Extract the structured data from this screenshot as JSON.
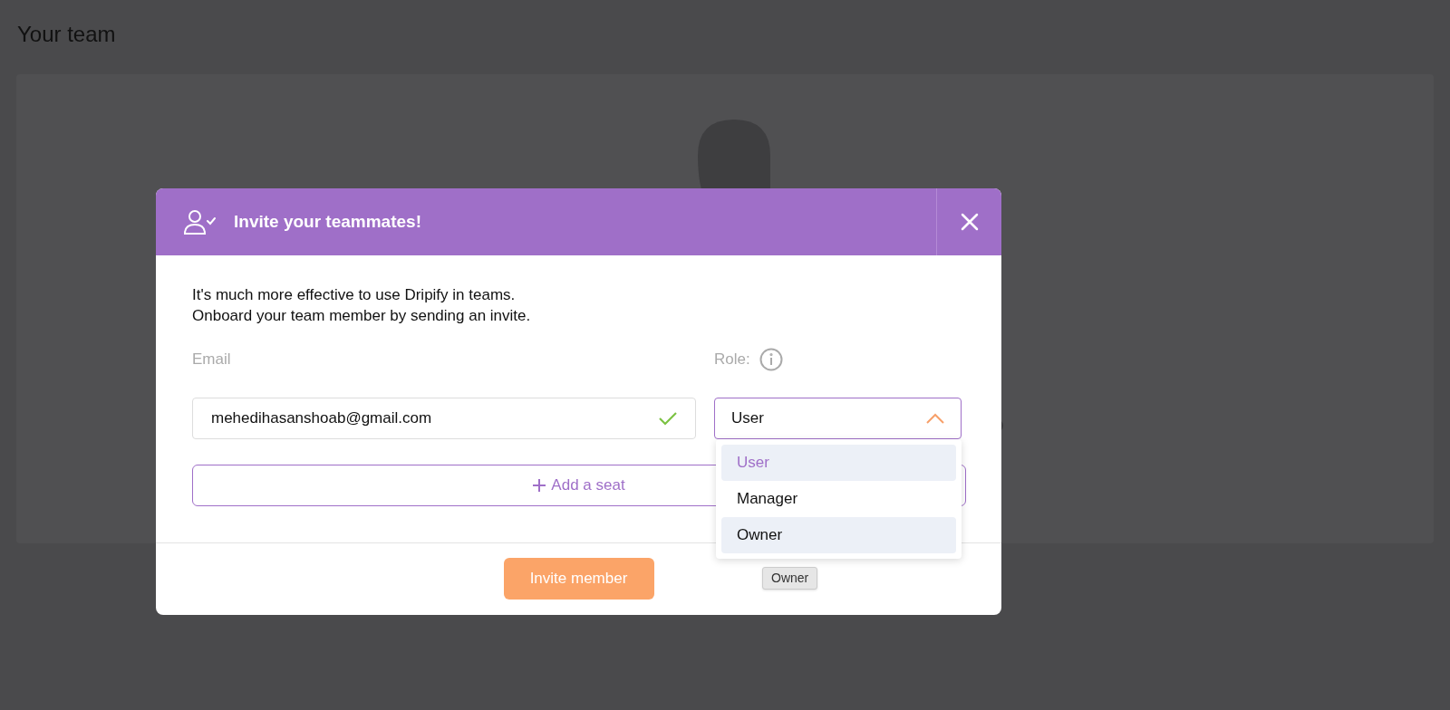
{
  "page": {
    "title": "Your team"
  },
  "dialog": {
    "title": "Invite your teammates!",
    "intro": [
      "It's much more effective to use Dripify in teams.",
      "Onboard your team member by sending an invite."
    ],
    "email": {
      "label": "Email",
      "value": "mehedihasanshoab@gmail.com",
      "valid": true
    },
    "role": {
      "label": "Role:",
      "value": "User",
      "expanded": true,
      "options": [
        {
          "label": "User",
          "selected": true,
          "hovered": false
        },
        {
          "label": "Manager",
          "selected": false,
          "hovered": false
        },
        {
          "label": "Owner",
          "selected": false,
          "hovered": true
        }
      ]
    },
    "add_seat": "Add a seat",
    "invite_button": "Invite member",
    "tooltip": "Owner"
  }
}
